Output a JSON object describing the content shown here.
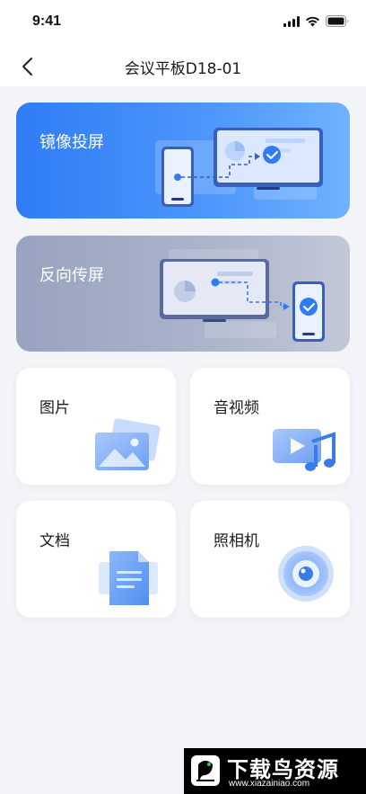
{
  "status_bar": {
    "time": "9:41"
  },
  "header": {
    "title": "会议平板D18-01"
  },
  "cards": {
    "mirror": {
      "label": "镜像投屏"
    },
    "reverse": {
      "label": "反向传屏"
    },
    "pictures": {
      "label": "图片"
    },
    "media": {
      "label": "音视频"
    },
    "documents": {
      "label": "文档"
    },
    "camera": {
      "label": "照相机"
    }
  },
  "watermark": {
    "text": "下载鸟资源",
    "url": "www.xiazainiao.com"
  },
  "colors": {
    "primary": "#2f7cf6",
    "reverse_card": "#99a3bf",
    "background": "#f3f4f7"
  },
  "icons": [
    "back-chevron",
    "signal-bars",
    "wifi",
    "battery",
    "phone-to-tablet",
    "tablet-to-phone",
    "picture",
    "video-music",
    "document",
    "camera-lens"
  ]
}
